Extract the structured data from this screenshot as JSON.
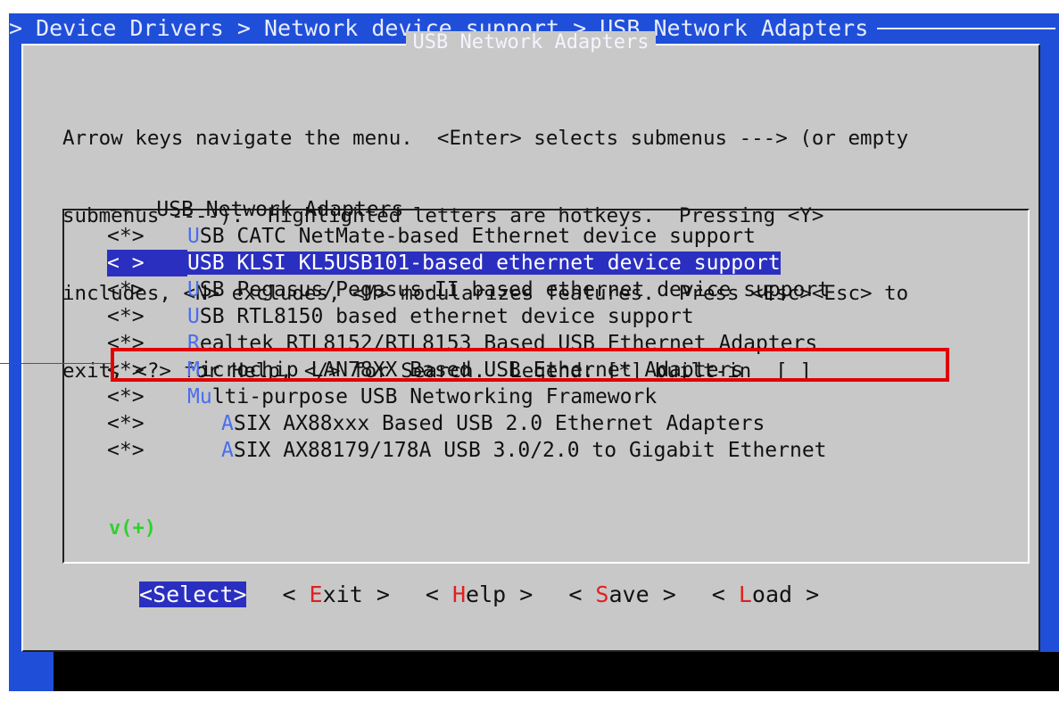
{
  "title_bar": "> Device Drivers > Network device support > USB Network Adapters",
  "dialog_title": "USB Network Adapters",
  "help_lines": [
    "Arrow keys navigate the menu.  <Enter> selects submenus ---> (or empty",
    "submenus ----).  Highlighted letters are hotkeys.  Pressing <Y>",
    "includes, <N> excludes, <M> modularizes features.  Press <Esc><Esc> to",
    "exit, <?> for Help, </> for Search.  Legend: [*] built-in  [ ]"
  ],
  "menu_header": "--- USB Network Adapters",
  "menu_items": [
    {
      "mark": "<*>",
      "hotkey": "U",
      "text": "SB CATC NetMate-based Ethernet device support"
    },
    {
      "mark": "< >",
      "hotkey": "",
      "text": "USB KLSI KL5USB101-based ethernet device support",
      "selected": true
    },
    {
      "mark": "<*>",
      "hotkey": "U",
      "text": "SB Pegasus/Pegasus-II based ethernet device support"
    },
    {
      "mark": "<*>",
      "hotkey": "U",
      "text": "SB RTL8150 based ethernet device support"
    },
    {
      "mark": "<*>",
      "hotkey": "R",
      "text": "ealtek RTL8152/RTL8153 Based USB Ethernet Adapters"
    },
    {
      "mark": "<*>",
      "hotkey": "M",
      "text": "icrochip LAN78XX Based USB Ethernet Adapters"
    },
    {
      "mark": "<*>",
      "hotkey": "Mu",
      "text": "lti-purpose USB Networking Framework"
    },
    {
      "mark": "<*>",
      "hotkey": "A",
      "text": "SIX AX88xxx Based USB 2.0 Ethernet Adapters",
      "indent": true
    },
    {
      "mark": "<*>",
      "hotkey": "A",
      "text": "SIX AX88179/178A USB 3.0/2.0 to Gigabit Ethernet",
      "indent": true
    }
  ],
  "more_indicator": "v(+)",
  "buttons": [
    {
      "pre": "<",
      "hotkey": "",
      "text": "Select",
      "post": ">",
      "active": true
    },
    {
      "pre": "< ",
      "hotkey": "E",
      "text": "xit",
      "post": " >"
    },
    {
      "pre": "< ",
      "hotkey": "H",
      "text": "elp",
      "post": " >"
    },
    {
      "pre": "< ",
      "hotkey": "S",
      "text": "ave",
      "post": " >"
    },
    {
      "pre": "< ",
      "hotkey": "L",
      "text": "oad",
      "post": " >"
    }
  ],
  "colors": {
    "screen_bg": "#1f4fd8",
    "dialog_bg": "#c8c8c8",
    "highlight": "#2b2fc0",
    "hotkey_menu": "#4a6df0",
    "hotkey_button": "#e02020",
    "callout": "#e00000",
    "more_indicator": "#30d030"
  }
}
